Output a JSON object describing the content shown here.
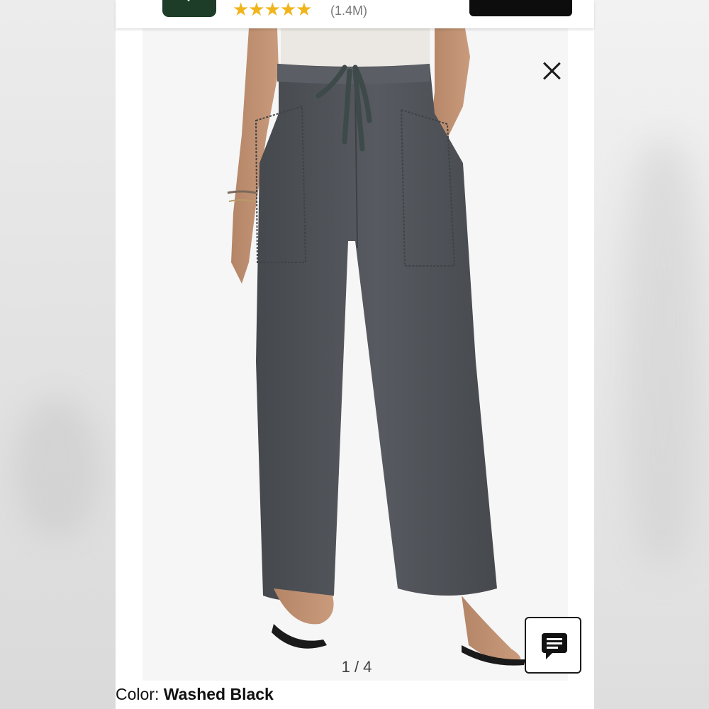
{
  "header": {
    "rating_stars": "★★★★★",
    "rating_count": "(1.4M)"
  },
  "gallery": {
    "page_counter": "1 / 4"
  },
  "product": {
    "color_prefix": "Color:",
    "color_value": "Washed Black"
  },
  "colors": {
    "accent_star": "#f0b51c",
    "app_icon": "#1e3d28",
    "pants": "#4f5257"
  }
}
